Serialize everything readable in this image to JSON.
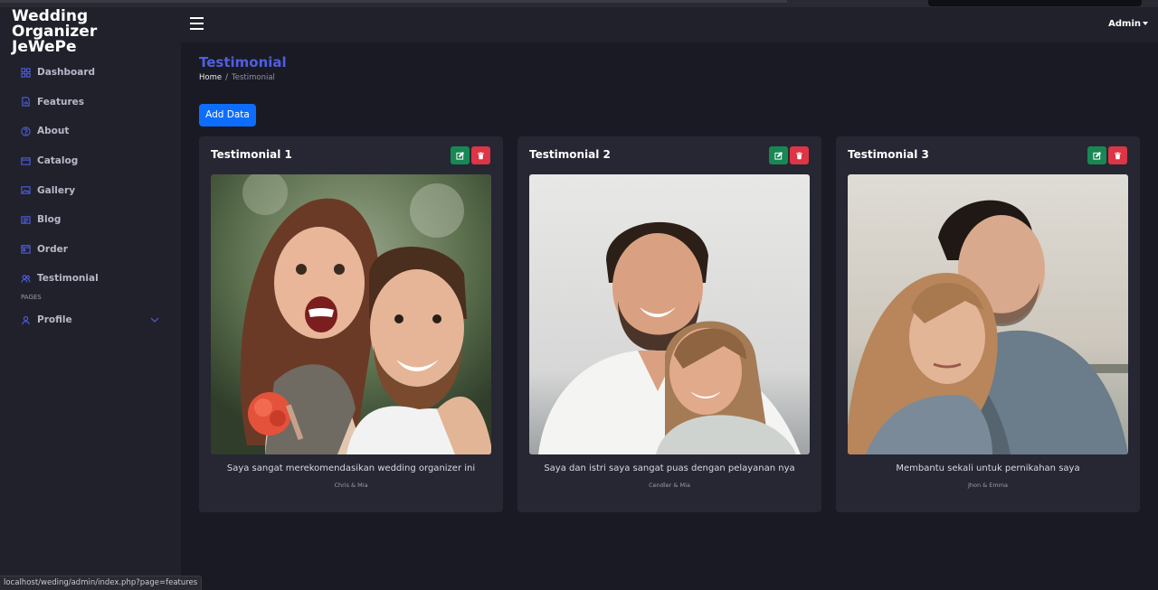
{
  "brand": {
    "line1": "Wedding Organizer",
    "line2": "JeWePe"
  },
  "sidebar": {
    "items": [
      {
        "label": "Dashboard",
        "icon": "grid-icon"
      },
      {
        "label": "Features",
        "icon": "chart-icon"
      },
      {
        "label": "About",
        "icon": "question-icon"
      },
      {
        "label": "Catalog",
        "icon": "catalog-icon"
      },
      {
        "label": "Gallery",
        "icon": "image-icon"
      },
      {
        "label": "Blog",
        "icon": "blog-icon"
      },
      {
        "label": "Order",
        "icon": "order-icon"
      },
      {
        "label": "Testimonial",
        "icon": "people-icon"
      }
    ],
    "section_label": "PAGES",
    "profile_label": "Profile"
  },
  "topbar": {
    "user": "Admin"
  },
  "page": {
    "title": "Testimonial",
    "breadcrumb_home": "Home",
    "breadcrumb_separator": "/",
    "breadcrumb_current": "Testimonial",
    "add_button": "Add Data"
  },
  "testimonials": [
    {
      "title": "Testimonial 1",
      "quote": "Saya sangat merekomendasikan wedding organizer ini",
      "author": "Chris & Mia"
    },
    {
      "title": "Testimonial 2",
      "quote": "Saya dan istri saya sangat puas dengan pelayanan nya",
      "author": "Cendler & Mia"
    },
    {
      "title": "Testimonial 3",
      "quote": "Membantu sekali untuk pernikahan saya",
      "author": "Jhon & Emma"
    }
  ],
  "statusbar": {
    "url": "localhost/weding/admin/index.php?page=features"
  },
  "colors": {
    "accent": "#4f5fe0",
    "primary_button": "#0d6efd",
    "edit_button": "#198754",
    "delete_button": "#dc3545",
    "sidebar_bg": "#20212b",
    "content_bg": "#1a1a24",
    "card_bg": "#262733"
  }
}
